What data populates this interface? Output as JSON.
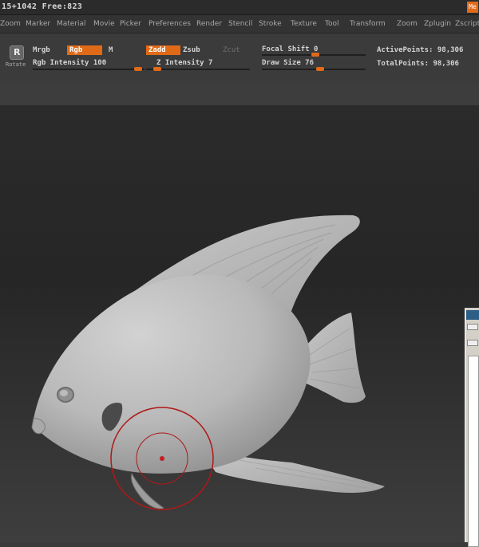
{
  "titlebar": {
    "text": "15+1042 Free:823",
    "badge": "Me"
  },
  "menu": [
    "Zoom",
    "Marker",
    "Material",
    "Movie",
    "Picker",
    "Preferences",
    "Render",
    "Stencil",
    "Stroke",
    "Texture",
    "Tool",
    "Transform",
    "Zoom",
    "Zplugin",
    "Zscript"
  ],
  "toolbar": {
    "rotate_label": "Rotate",
    "rotate_glyph": "R",
    "mrgb_label": "Mrgb",
    "rgb_label": "Rgb",
    "m_label": "M",
    "rgb_intensity_label": "Rgb Intensity 100",
    "rgb_intensity_value": 100,
    "zadd_label": "Zadd",
    "zsub_label": "Zsub",
    "zcut_label": "Zcut",
    "z_intensity_label": "Z Intensity 7",
    "z_intensity_value": 7,
    "focal_shift_label": "Focal Shift 0",
    "focal_shift_value": 0,
    "draw_size_label": "Draw Size 76",
    "draw_size_value": 76,
    "active_points_label": "ActivePoints: 98,306",
    "total_points_label": "TotalPoints: 98,306"
  },
  "colors": {
    "accent": "#e06a17",
    "canvas": "#2a2a2a",
    "model": "#bdbdbd",
    "brush_ring": "#c41e1e"
  }
}
